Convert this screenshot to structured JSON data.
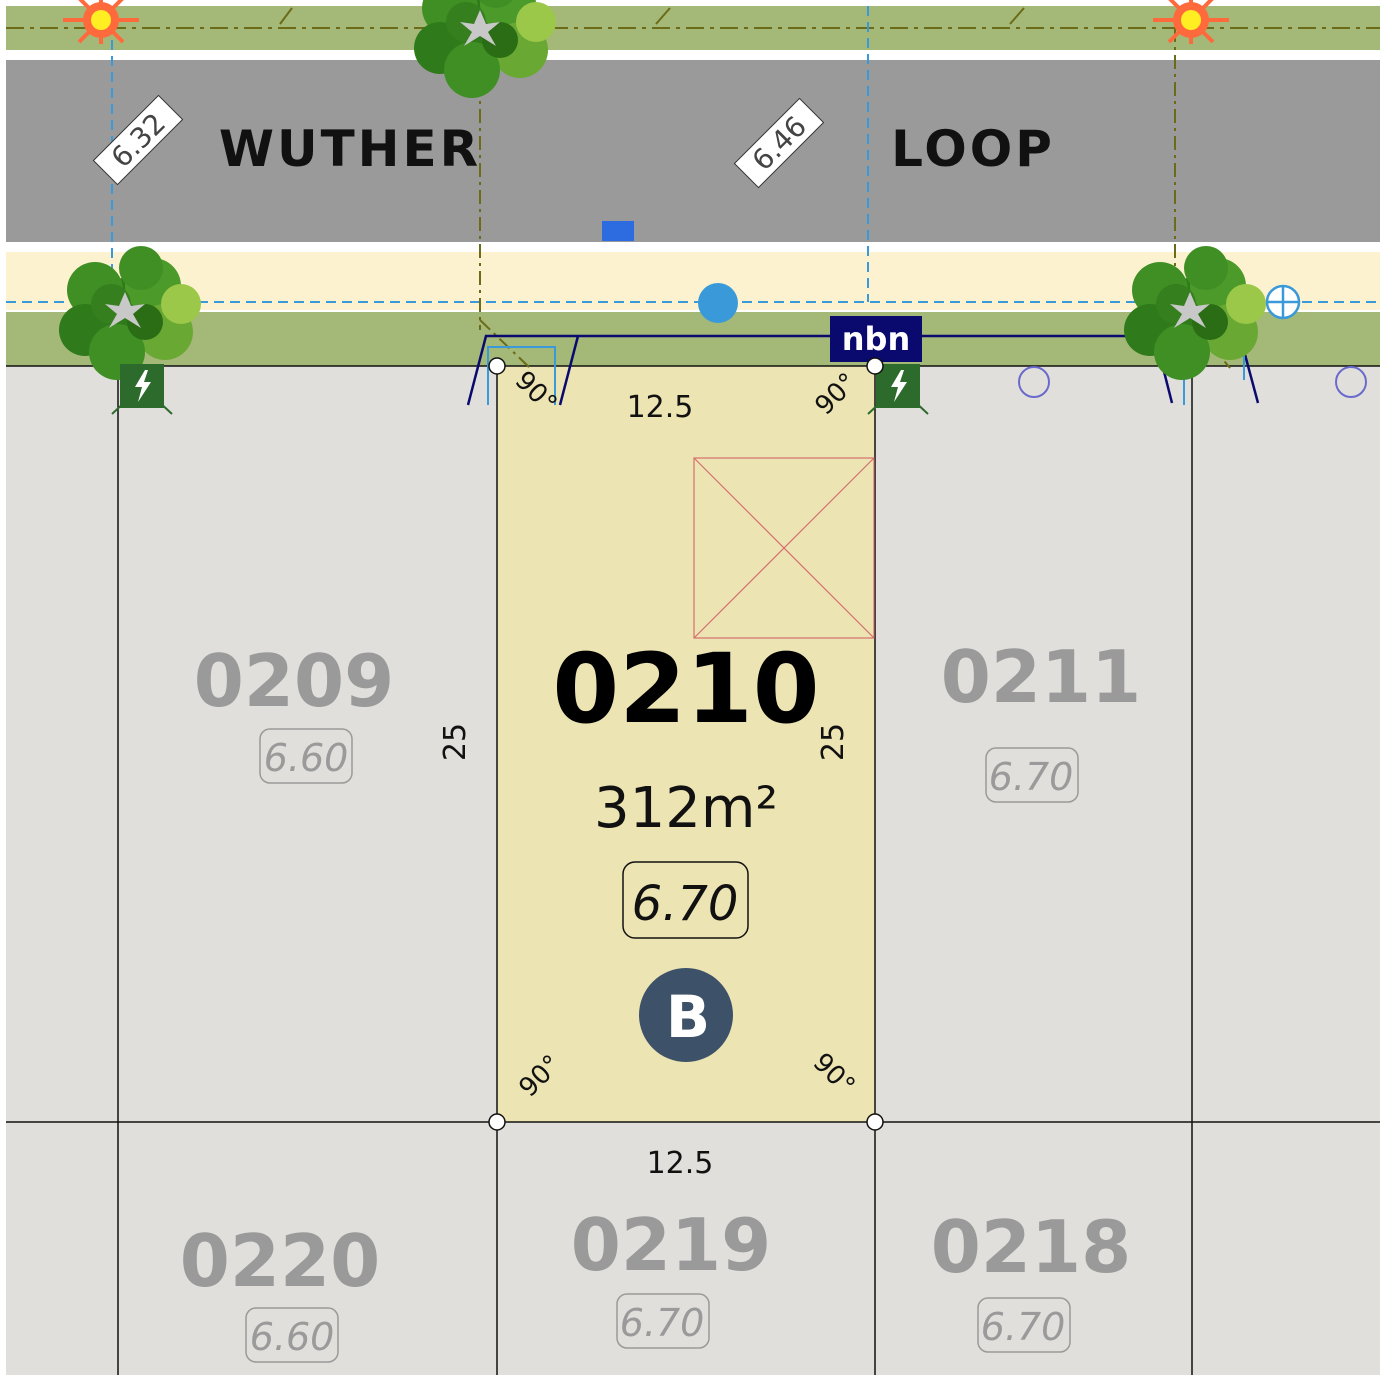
{
  "street": {
    "name_left": "WUTHER",
    "name_right": "LOOP",
    "levels": [
      "6.32",
      "6.46"
    ]
  },
  "nbn_label": "nbn",
  "selected_lot": {
    "number": "0210",
    "area": "312m²",
    "level": "6.70",
    "badge": "B",
    "frontage": "12.5",
    "rear": "12.5",
    "depth_left": "25",
    "depth_right": "25",
    "angle": "90°"
  },
  "lots": {
    "l0209": {
      "number": "0209",
      "level": "6.60"
    },
    "l0211": {
      "number": "0211",
      "level": "6.70"
    },
    "l0220": {
      "number": "0220",
      "level": "6.60"
    },
    "l0219": {
      "number": "0219",
      "level": "6.70"
    },
    "l0218": {
      "number": "0218",
      "level": "6.70"
    }
  },
  "colors": {
    "road": "#9a9a9a",
    "verge": "#a4b878",
    "footpath": "#fdf2cf",
    "lot": "#e0dfdb",
    "selected_lot": "#ece4b3",
    "badge": "#3d5168",
    "nbn": "#0a0a6e",
    "service_line": "#3a9ad9",
    "tree": "#3f8f24"
  },
  "icons": [
    "street-light-icon",
    "tree-icon",
    "power-pit-icon",
    "nbn-pit-icon",
    "water-service-icon",
    "drainage-pit-icon",
    "manhole-icon",
    "crossover-icon",
    "building-envelope-icon"
  ]
}
